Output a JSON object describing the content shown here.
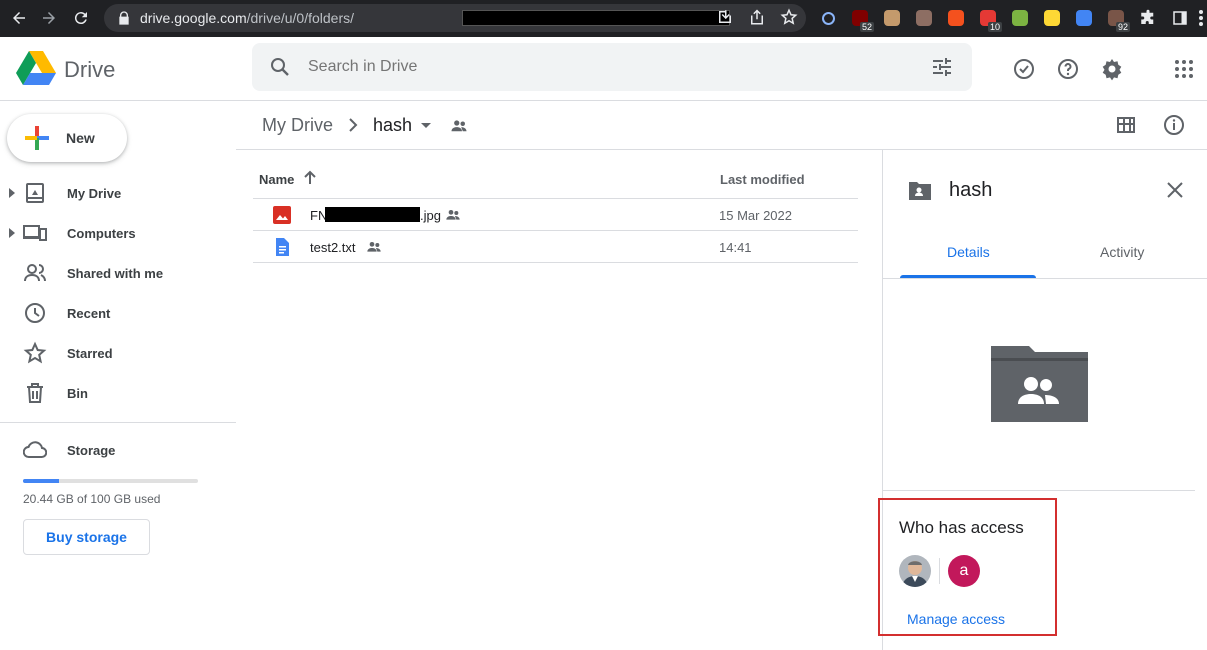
{
  "browser": {
    "url_host": "drive.google.com",
    "url_path": "/drive/u/0/folders/",
    "extensions": [
      {
        "icon": "search-ext-icon",
        "color": "#8ab4f8",
        "badge": ""
      },
      {
        "icon": "ublock-icon",
        "color": "#800000",
        "badge": "52"
      },
      {
        "icon": "ext-bird-icon",
        "color": "#c49a6c",
        "badge": ""
      },
      {
        "icon": "ext-cookie-icon",
        "color": "#8d6e63",
        "badge": ""
      },
      {
        "icon": "ext-lighthouse-icon",
        "color": "#f4511e",
        "badge": ""
      },
      {
        "icon": "ext-calendar-icon",
        "color": "#e53935",
        "badge": "10"
      },
      {
        "icon": "ext-color-icon",
        "color": "#7cb342",
        "badge": ""
      },
      {
        "icon": "ext-pen-icon",
        "color": "#fdd835",
        "badge": ""
      },
      {
        "icon": "ext-translate-icon",
        "color": "#4285f4",
        "badge": ""
      },
      {
        "icon": "ext-tree-icon",
        "color": "#795548",
        "badge": "92"
      }
    ]
  },
  "header": {
    "app_name": "Drive",
    "search_placeholder": "Search in Drive"
  },
  "sidebar": {
    "new_label": "New",
    "items": [
      {
        "label": "My Drive",
        "icon": "my-drive-icon",
        "expandable": true
      },
      {
        "label": "Computers",
        "icon": "computers-icon",
        "expandable": true
      },
      {
        "label": "Shared with me",
        "icon": "shared-with-me-icon",
        "expandable": false
      },
      {
        "label": "Recent",
        "icon": "clock-icon",
        "expandable": false
      },
      {
        "label": "Starred",
        "icon": "star-icon",
        "expandable": false
      },
      {
        "label": "Bin",
        "icon": "bin-icon",
        "expandable": false
      }
    ],
    "storage_label": "Storage",
    "storage_used_fraction": 0.2044,
    "storage_text": "20.44 GB of 100 GB used",
    "buy_storage_label": "Buy storage"
  },
  "breadcrumb": {
    "root": "My Drive",
    "current": "hash"
  },
  "file_list": {
    "col_name": "Name",
    "col_modified": "Last modified",
    "rows": [
      {
        "name_prefix": "FN",
        "name_suffix": ".jpg",
        "type": "image",
        "modified": "15 Mar 2022",
        "shared": true
      },
      {
        "name_prefix": "test2.txt",
        "name_suffix": "",
        "type": "doc",
        "modified": "14:41",
        "shared": true
      }
    ]
  },
  "details": {
    "title": "hash",
    "tab_details": "Details",
    "tab_activity": "Activity",
    "who_has_access": "Who has access",
    "avatar_letter": "a",
    "manage_access": "Manage access"
  },
  "colors": {
    "accent": "#1a73e8",
    "highlight_box": "#d32f2f",
    "avatar_letter_bg": "#c2185b"
  }
}
